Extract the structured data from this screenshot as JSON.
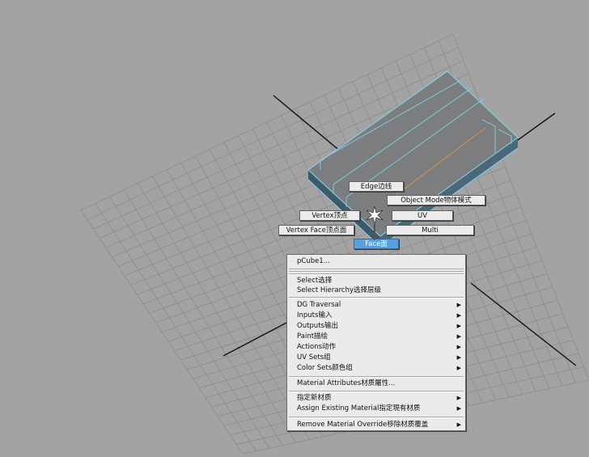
{
  "marking_menu": {
    "edge": "Edge边线",
    "object_mode": "Object Mode物体模式",
    "vertex": "Vertex顶点",
    "uv": "UV",
    "vertex_face": "Vertex Face顶点面",
    "multi": "Multi",
    "face": "Face面"
  },
  "context_menu": {
    "object_name": "pCube1...",
    "select": "Select选择",
    "select_hierarchy": "Select Hierarchy选择层级",
    "dg_traversal": "DG Traversal",
    "inputs": "Inputs输入",
    "outputs": "Outputs输出",
    "paint": "Paint描绘",
    "actions": "Actions动作",
    "uv_sets": "UV Sets组",
    "color_sets": "Color Sets颜色组",
    "material_attributes": "Material Attributes材质屬性...",
    "assign_new_material": "指定新材质",
    "assign_existing_material": "Assign Existing Material指定現有材质",
    "remove_material_override": "Remove Material Override移除材质覆盖",
    "submenu_arrow": "▶"
  },
  "colors": {
    "viewport_background": "#a3a3a3",
    "grid_line": "#8c8c8c",
    "axis_line": "#111111",
    "mesh_top": "#7b7d7e",
    "mesh_edge_highlight": "#7fd3ea",
    "menu_background": "#ebebeb",
    "selected_item": "#5a9fe0"
  }
}
